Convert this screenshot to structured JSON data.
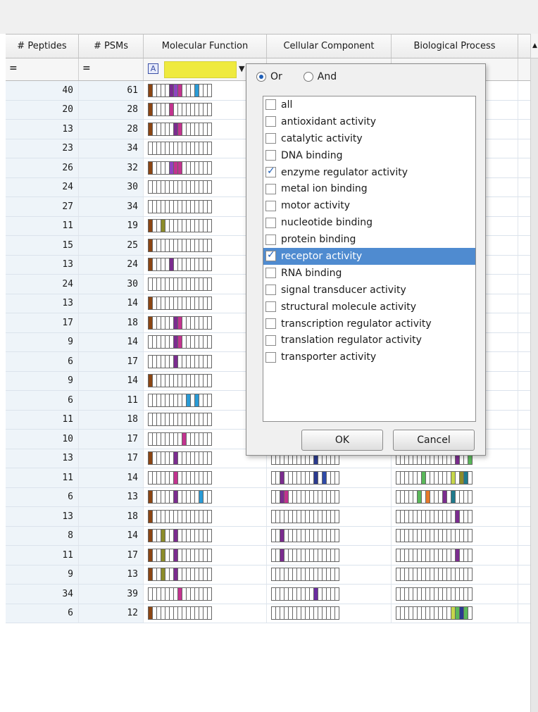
{
  "columns": [
    "# Peptides",
    "# PSMs",
    "Molecular Function",
    "Cellular Component",
    "Biological Process"
  ],
  "filter_row": {
    "peptides_op": "=",
    "psms_op": "=",
    "mf_filter_icon": "A"
  },
  "colors": {
    "brown": "#8b4513",
    "olive": "#8c8c2a",
    "purple": "#7b2c8f",
    "magenta": "#c2338f",
    "pink": "#d94a9c",
    "cyan": "#2a9bd6",
    "blue": "#2e4aa8",
    "teal": "#1f7a8c",
    "green": "#5ab85a",
    "lime": "#c6d64a",
    "orange": "#e67a2a",
    "violet": "#8e44c0",
    "navy": "#2b3a8f",
    "darkpurple": "#6a2ca0",
    "rowbg": "#eef4f9",
    "highlight_yellow": "#efea3e",
    "select_blue": "#4f8bd0"
  },
  "rows": [
    {
      "peptides": "40",
      "psms": "61",
      "mf": [
        [
          0,
          "brown"
        ],
        [
          5,
          "purple"
        ],
        [
          6,
          "violet"
        ],
        [
          7,
          "magenta"
        ],
        [
          11,
          "cyan"
        ],
        [
          15,
          "purple"
        ]
      ],
      "cc": [],
      "bp": [
        [
          15,
          "teal"
        ],
        [
          17,
          "green"
        ]
      ]
    },
    {
      "peptides": "20",
      "psms": "28",
      "mf": [
        [
          0,
          "brown"
        ],
        [
          5,
          "magenta"
        ]
      ],
      "cc": [],
      "bp": []
    },
    {
      "peptides": "13",
      "psms": "28",
      "mf": [
        [
          0,
          "brown"
        ],
        [
          6,
          "purple"
        ],
        [
          7,
          "magenta"
        ],
        [
          15,
          "purple"
        ]
      ],
      "cc": [],
      "bp": [
        [
          15,
          "navy"
        ],
        [
          16,
          "green"
        ]
      ]
    },
    {
      "peptides": "23",
      "psms": "34",
      "mf": [],
      "cc": [],
      "bp": []
    },
    {
      "peptides": "26",
      "psms": "32",
      "mf": [
        [
          0,
          "brown"
        ],
        [
          5,
          "violet"
        ],
        [
          6,
          "magenta"
        ],
        [
          7,
          "magenta"
        ],
        [
          15,
          "purple"
        ]
      ],
      "cc": [],
      "bp": [
        [
          15,
          "teal"
        ],
        [
          16,
          "green"
        ]
      ]
    },
    {
      "peptides": "24",
      "psms": "30",
      "mf": [
        [
          15,
          "purple"
        ]
      ],
      "cc": [],
      "bp": [
        [
          15,
          "teal"
        ],
        [
          16,
          "green"
        ]
      ]
    },
    {
      "peptides": "27",
      "psms": "34",
      "mf": [
        [
          15,
          "purple"
        ]
      ],
      "cc": [],
      "bp": [
        [
          17,
          "green"
        ]
      ]
    },
    {
      "peptides": "11",
      "psms": "19",
      "mf": [
        [
          0,
          "brown"
        ],
        [
          3,
          "olive"
        ]
      ],
      "cc": [],
      "bp": [
        [
          15,
          "teal"
        ]
      ]
    },
    {
      "peptides": "15",
      "psms": "25",
      "mf": [
        [
          0,
          "brown"
        ]
      ],
      "cc": [],
      "bp": []
    },
    {
      "peptides": "13",
      "psms": "24",
      "mf": [
        [
          0,
          "brown"
        ],
        [
          5,
          "purple"
        ]
      ],
      "cc": [],
      "bp": []
    },
    {
      "peptides": "24",
      "psms": "30",
      "mf": [
        [
          15,
          "purple"
        ]
      ],
      "cc": [],
      "bp": [
        [
          17,
          "green"
        ]
      ]
    },
    {
      "peptides": "13",
      "psms": "14",
      "mf": [
        [
          0,
          "brown"
        ]
      ],
      "cc": [],
      "bp": []
    },
    {
      "peptides": "17",
      "psms": "18",
      "mf": [
        [
          0,
          "brown"
        ],
        [
          6,
          "purple"
        ],
        [
          7,
          "magenta"
        ]
      ],
      "cc": [],
      "bp": [
        [
          15,
          "teal"
        ],
        [
          16,
          "green"
        ]
      ]
    },
    {
      "peptides": "9",
      "psms": "14",
      "mf": [
        [
          6,
          "purple"
        ],
        [
          7,
          "magenta"
        ]
      ],
      "cc": [],
      "bp": [
        [
          15,
          "navy"
        ],
        [
          16,
          "green"
        ]
      ]
    },
    {
      "peptides": "6",
      "psms": "17",
      "mf": [
        [
          6,
          "purple"
        ]
      ],
      "cc": [],
      "bp": []
    },
    {
      "peptides": "9",
      "psms": "14",
      "mf": [
        [
          0,
          "brown"
        ]
      ],
      "cc": [],
      "bp": [
        [
          15,
          "green"
        ]
      ]
    },
    {
      "peptides": "6",
      "psms": "11",
      "mf": [
        [
          9,
          "cyan"
        ],
        [
          11,
          "cyan"
        ]
      ],
      "cc": [
        [
          3,
          "purple"
        ],
        [
          14,
          "magenta"
        ]
      ],
      "bp": [
        [
          13,
          "olive"
        ],
        [
          14,
          "lime"
        ],
        [
          15,
          "navy"
        ]
      ]
    },
    {
      "peptides": "11",
      "psms": "18",
      "mf": [
        [
          15,
          "purple"
        ]
      ],
      "cc": [
        [
          2,
          "purple"
        ],
        [
          10,
          "navy"
        ],
        [
          11,
          "navy"
        ]
      ],
      "bp": [
        [
          15,
          "green"
        ],
        [
          17,
          "green"
        ]
      ]
    },
    {
      "peptides": "10",
      "psms": "17",
      "mf": [
        [
          8,
          "magenta"
        ],
        [
          15,
          "purple"
        ]
      ],
      "cc": [
        [
          2,
          "purple"
        ],
        [
          10,
          "navy"
        ],
        [
          11,
          "navy"
        ]
      ],
      "bp": [
        [
          1,
          "olive"
        ],
        [
          5,
          "green"
        ],
        [
          12,
          "lime"
        ],
        [
          14,
          "teal"
        ],
        [
          16,
          "green"
        ]
      ]
    },
    {
      "peptides": "13",
      "psms": "17",
      "mf": [
        [
          0,
          "brown"
        ],
        [
          6,
          "purple"
        ],
        [
          15,
          "purple"
        ]
      ],
      "cc": [
        [
          10,
          "navy"
        ]
      ],
      "bp": [
        [
          14,
          "purple"
        ],
        [
          17,
          "green"
        ]
      ]
    },
    {
      "peptides": "11",
      "psms": "14",
      "mf": [
        [
          6,
          "magenta"
        ]
      ],
      "cc": [
        [
          2,
          "purple"
        ],
        [
          10,
          "navy"
        ],
        [
          12,
          "blue"
        ]
      ],
      "bp": [
        [
          6,
          "green"
        ],
        [
          13,
          "lime"
        ],
        [
          15,
          "olive"
        ],
        [
          16,
          "teal"
        ]
      ]
    },
    {
      "peptides": "6",
      "psms": "13",
      "mf": [
        [
          0,
          "brown"
        ],
        [
          6,
          "purple"
        ],
        [
          12,
          "cyan"
        ]
      ],
      "cc": [
        [
          2,
          "purple"
        ],
        [
          3,
          "magenta"
        ]
      ],
      "bp": [
        [
          5,
          "green"
        ],
        [
          7,
          "orange"
        ],
        [
          11,
          "purple"
        ],
        [
          13,
          "teal"
        ]
      ]
    },
    {
      "peptides": "13",
      "psms": "18",
      "mf": [
        [
          0,
          "brown"
        ]
      ],
      "cc": [],
      "bp": [
        [
          14,
          "purple"
        ]
      ]
    },
    {
      "peptides": "8",
      "psms": "14",
      "mf": [
        [
          0,
          "brown"
        ],
        [
          3,
          "olive"
        ],
        [
          6,
          "purple"
        ]
      ],
      "cc": [
        [
          2,
          "purple"
        ]
      ],
      "bp": []
    },
    {
      "peptides": "11",
      "psms": "17",
      "mf": [
        [
          0,
          "brown"
        ],
        [
          3,
          "olive"
        ],
        [
          6,
          "purple"
        ]
      ],
      "cc": [
        [
          2,
          "purple"
        ]
      ],
      "bp": [
        [
          14,
          "purple"
        ]
      ]
    },
    {
      "peptides": "9",
      "psms": "13",
      "mf": [
        [
          0,
          "brown"
        ],
        [
          3,
          "olive"
        ],
        [
          6,
          "purple"
        ]
      ],
      "cc": [],
      "bp": []
    },
    {
      "peptides": "34",
      "psms": "39",
      "mf": [
        [
          7,
          "magenta"
        ]
      ],
      "cc": [
        [
          10,
          "darkpurple"
        ]
      ],
      "bp": []
    },
    {
      "peptides": "6",
      "psms": "12",
      "mf": [
        [
          0,
          "brown"
        ]
      ],
      "cc": [],
      "bp": [
        [
          13,
          "lime"
        ],
        [
          14,
          "green"
        ],
        [
          15,
          "navy"
        ],
        [
          16,
          "green"
        ]
      ]
    }
  ],
  "popup": {
    "radio_or": "Or",
    "radio_and": "And",
    "mode": "Or",
    "items": [
      {
        "label": "all",
        "checked": false,
        "selected": false
      },
      {
        "label": "antioxidant activity",
        "checked": false,
        "selected": false
      },
      {
        "label": "catalytic activity",
        "checked": false,
        "selected": false
      },
      {
        "label": "DNA binding",
        "checked": false,
        "selected": false
      },
      {
        "label": "enzyme regulator activity",
        "checked": true,
        "selected": false
      },
      {
        "label": "metal ion binding",
        "checked": false,
        "selected": false
      },
      {
        "label": "motor activity",
        "checked": false,
        "selected": false
      },
      {
        "label": "nucleotide binding",
        "checked": false,
        "selected": false
      },
      {
        "label": "protein binding",
        "checked": false,
        "selected": false
      },
      {
        "label": "receptor activity",
        "checked": true,
        "selected": true
      },
      {
        "label": "RNA binding",
        "checked": false,
        "selected": false
      },
      {
        "label": "signal transducer activity",
        "checked": false,
        "selected": false
      },
      {
        "label": "structural molecule activity",
        "checked": false,
        "selected": false
      },
      {
        "label": "transcription regulator activity",
        "checked": false,
        "selected": false
      },
      {
        "label": "translation regulator activity",
        "checked": false,
        "selected": false
      },
      {
        "label": "transporter activity",
        "checked": false,
        "selected": false
      }
    ],
    "ok_label": "OK",
    "cancel_label": "Cancel"
  }
}
